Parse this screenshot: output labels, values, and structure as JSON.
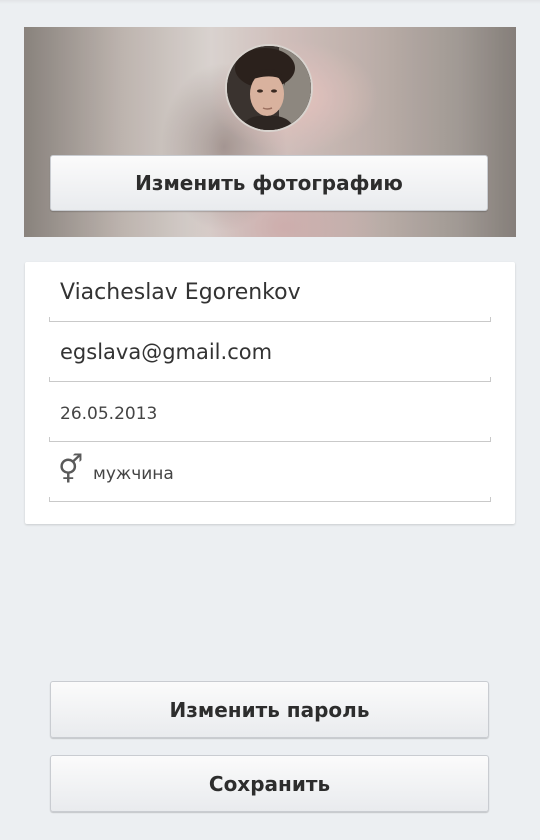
{
  "profile": {
    "change_photo_label": "Изменить фотографию",
    "name": "Viacheslav Egorenkov",
    "email": "egslava@gmail.com",
    "birth_date": "26.05.2013",
    "gender_icon": "male-female-icon",
    "gender_glyph": "⚥",
    "gender": "мужчина"
  },
  "actions": {
    "change_password_label": "Изменить пароль",
    "save_label": "Сохранить"
  },
  "colors": {
    "background": "#eceff2",
    "card": "#ffffff",
    "button_text": "#2d2d2d"
  }
}
